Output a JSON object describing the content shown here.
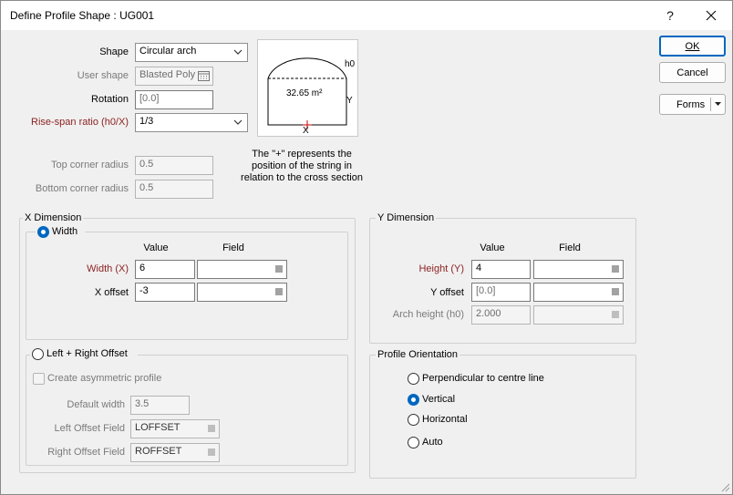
{
  "window": {
    "title": "Define Profile Shape : UG001",
    "help_label": "?",
    "close_label": "✕"
  },
  "shape": {
    "label": "Shape",
    "value": "Circular arch"
  },
  "user_shape": {
    "label": "User shape",
    "value": "Blasted Poly"
  },
  "rotation": {
    "label": "Rotation",
    "value": "[0.0]"
  },
  "rise_span": {
    "label": "Rise-span ratio (h0/X)",
    "value": "1/3"
  },
  "top_corner": {
    "label": "Top corner radius",
    "value": "0.5"
  },
  "bottom_corner": {
    "label": "Bottom corner radius",
    "value": "0.5"
  },
  "diagram": {
    "h0": "h0",
    "area": "32.65 m²",
    "y": "Y",
    "x": "X"
  },
  "note": [
    "The \"+\" represents the",
    "position of the string in",
    "relation to the cross section"
  ],
  "x_dim": {
    "title": "X Dimension",
    "width_radio": "Width",
    "col_value": "Value",
    "col_field": "Field",
    "width": {
      "label": "Width (X)",
      "value": "6",
      "field": ""
    },
    "offset": {
      "label": "X offset",
      "value": "-3",
      "field": ""
    }
  },
  "lr_offset": {
    "title": "Left + Right Offset",
    "asym": "Create asymmetric profile",
    "default_width": {
      "label": "Default width",
      "value": "3.5"
    },
    "left_field": {
      "label": "Left Offset Field",
      "value": "LOFFSET"
    },
    "right_field": {
      "label": "Right Offset Field",
      "value": "ROFFSET"
    }
  },
  "y_dim": {
    "title": "Y Dimension",
    "col_value": "Value",
    "col_field": "Field",
    "height": {
      "label": "Height (Y)",
      "value": "4",
      "field": ""
    },
    "offset": {
      "label": "Y offset",
      "value": "[0.0]",
      "field": ""
    },
    "arch": {
      "label": "Arch height (h0)",
      "value": "2.000",
      "field": ""
    }
  },
  "orientation": {
    "title": "Profile Orientation",
    "options": [
      "Perpendicular to centre line",
      "Vertical",
      "Horizontal",
      "Auto"
    ],
    "selected": "Vertical"
  },
  "buttons": {
    "ok": "OK",
    "cancel": "Cancel",
    "forms": "Forms"
  },
  "colors": {
    "accent": "#0067c0",
    "required_label": "#8b1f1f"
  }
}
